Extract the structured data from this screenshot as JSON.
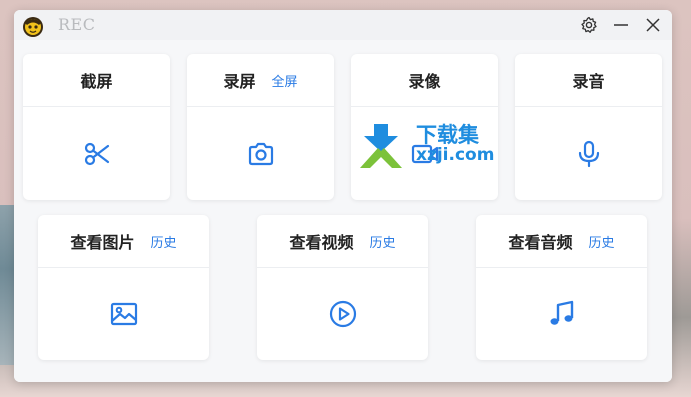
{
  "window": {
    "title": "REC"
  },
  "titlebar": {
    "settings_icon": "gear-icon",
    "minimize_icon": "minimize-icon",
    "close_icon": "close-icon"
  },
  "top_cards": [
    {
      "title": "截屏",
      "link": "",
      "icon": "scissors-icon"
    },
    {
      "title": "录屏",
      "link": "全屏",
      "icon": "camera-icon"
    },
    {
      "title": "录像",
      "link": "",
      "icon": "video-icon"
    },
    {
      "title": "录音",
      "link": "",
      "icon": "microphone-icon"
    }
  ],
  "bottom_cards": [
    {
      "title": "查看图片",
      "link": "历史",
      "icon": "image-icon"
    },
    {
      "title": "查看视频",
      "link": "历史",
      "icon": "play-circle-icon"
    },
    {
      "title": "查看音频",
      "link": "历史",
      "icon": "music-note-icon"
    }
  ],
  "watermark": {
    "line1": "下载集",
    "line2": "xzji.com"
  },
  "colors": {
    "accent": "#2a7be4",
    "titlebar": "#f1f2f4",
    "content_bg": "#f6f7f9"
  }
}
